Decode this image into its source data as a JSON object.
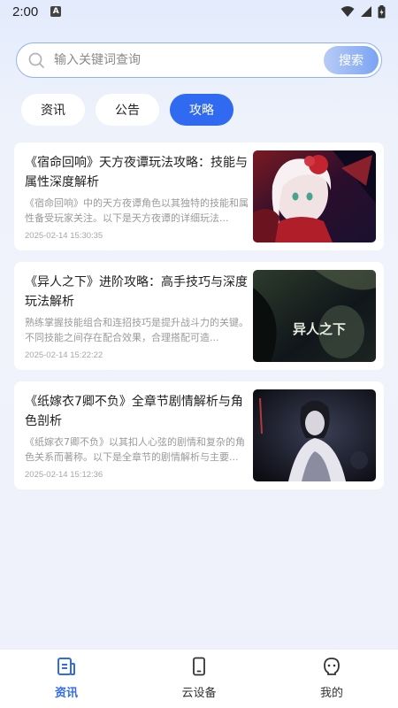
{
  "status_bar": {
    "time": "2:00",
    "a_badge": "A"
  },
  "search": {
    "placeholder": "输入关键词查询",
    "button_label": "搜索"
  },
  "tabs": [
    {
      "label": "资讯",
      "active": false
    },
    {
      "label": "公告",
      "active": false
    },
    {
      "label": "攻略",
      "active": true
    }
  ],
  "articles": [
    {
      "title": "《宿命回响》天方夜谭玩法攻略：技能与属性深度解析",
      "desc": "《宿命回响》中的天方夜谭角色以其独特的技能和属性备受玩家关注。以下是天方夜谭的详细玩法...",
      "time": "2025-02-14 15:30:35",
      "thumb": "anime-girl-red-roses"
    },
    {
      "title": "《异人之下》进阶攻略：高手技巧与深度玩法解析",
      "desc": "熟练掌握技能组合和连招技巧是提升战斗力的关键。不同技能之间存在配合效果，合理搭配可造...",
      "time": "2025-02-14 15:22:22",
      "thumb": "yiren-zhixia-poster",
      "thumb_text": "异人之下"
    },
    {
      "title": "《纸嫁衣7卿不负》全章节剧情解析与角色剖析",
      "desc": "《纸嫁衣7卿不负》以其扣人心弦的剧情和复杂的角色关系而著称。以下是全章节的剧情解析与主要...",
      "time": "2025-02-14 15:12:36",
      "thumb": "paper-bride-dark-art"
    }
  ],
  "bottom_nav": [
    {
      "label": "资讯",
      "icon": "news-icon",
      "active": true
    },
    {
      "label": "云设备",
      "icon": "phone-device-icon",
      "active": false
    },
    {
      "label": "我的",
      "icon": "profile-icon",
      "active": false
    }
  ],
  "colors": {
    "accent": "#2f6af0",
    "search_border": "#8fb2f3",
    "background": "#eef1fb"
  }
}
